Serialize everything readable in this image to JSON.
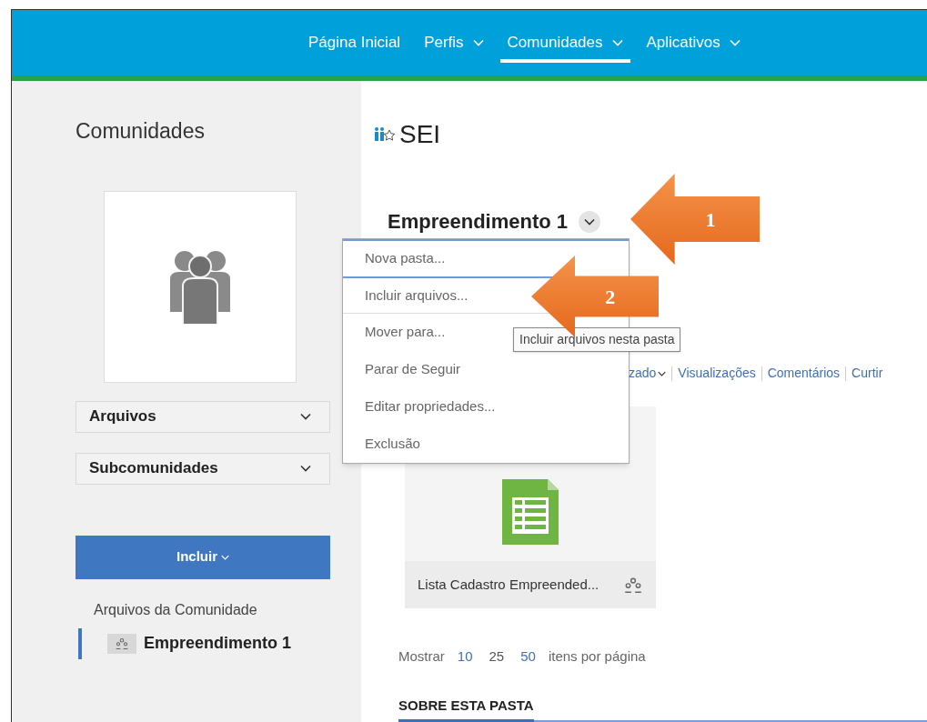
{
  "nav": {
    "items": [
      {
        "label": "Página Inicial",
        "dropdown": false,
        "selected": false
      },
      {
        "label": "Perfis",
        "dropdown": true,
        "selected": false
      },
      {
        "label": "Comunidades",
        "dropdown": true,
        "selected": true
      },
      {
        "label": "Aplicativos",
        "dropdown": true,
        "selected": false
      }
    ]
  },
  "sidebar": {
    "title": "Comunidades",
    "sections": [
      {
        "label": "Arquivos"
      },
      {
        "label": "Subcomunidades"
      }
    ],
    "button": "Incluir",
    "tree_heading": "Arquivos da Comunidade",
    "tree_items": [
      {
        "label": "Empreendimento 1",
        "selected": true
      }
    ]
  },
  "community": {
    "name": "SEI"
  },
  "folder": {
    "title": "Empreendimento 1"
  },
  "menu": {
    "items": [
      {
        "label": "Nova pasta...",
        "selected": false
      },
      {
        "label": "Incluir arquivos...",
        "selected": true
      },
      {
        "label": "Mover para...",
        "selected": false
      },
      {
        "label": "Parar de Seguir",
        "selected": false
      },
      {
        "label": "Editar propriedades...",
        "selected": false
      },
      {
        "label": "Exclusão",
        "selected": false
      }
    ]
  },
  "tooltip": "Incluir arquivos nesta pasta",
  "sort_links": [
    "zado",
    "Visualizações",
    "Comentários",
    "Curtir"
  ],
  "files": [
    {
      "name": "Lista Cadastro Empreended..."
    }
  ],
  "paging": {
    "prefix": "Mostrar",
    "sizes": [
      {
        "label": "10",
        "selected": false
      },
      {
        "label": "25",
        "selected": true
      },
      {
        "label": "50",
        "selected": false
      }
    ],
    "suffix": "itens por página"
  },
  "about_heading": "SOBRE ESTA PASTA",
  "callouts": [
    {
      "label": "1"
    },
    {
      "label": "2"
    }
  ]
}
